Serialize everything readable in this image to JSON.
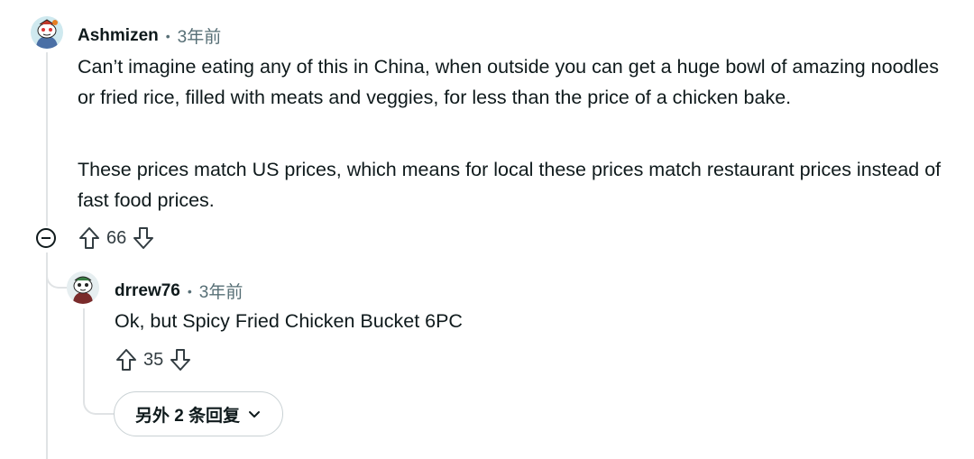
{
  "comment": {
    "author": "Ashmizen",
    "separator": "•",
    "time": "3年前",
    "paragraphs": [
      "Can’t imagine eating any of this in China, when outside you can get a huge bowl of amazing noodles or fried rice, filled with meats and veggies, for less than the price of a chicken bake.",
      "These prices match US prices, which means for local these prices match restaurant prices instead of fast food prices."
    ],
    "score": "66",
    "avatar_icon": "snoo-avatar-icon"
  },
  "reply": {
    "author": "drrew76",
    "separator": "•",
    "time": "3年前",
    "text": "Ok, but Spicy Fried Chicken Bucket 6PC",
    "score": "35",
    "avatar_icon": "snoo-avatar-icon"
  },
  "more_replies": {
    "label": "另外 2 条回复",
    "icon": "chevron-down-icon"
  },
  "colors": {
    "text": "#0f1a1c",
    "meta": "#576f76",
    "thread_line": "#e0e3e5",
    "button_border": "#c9d1d4"
  }
}
